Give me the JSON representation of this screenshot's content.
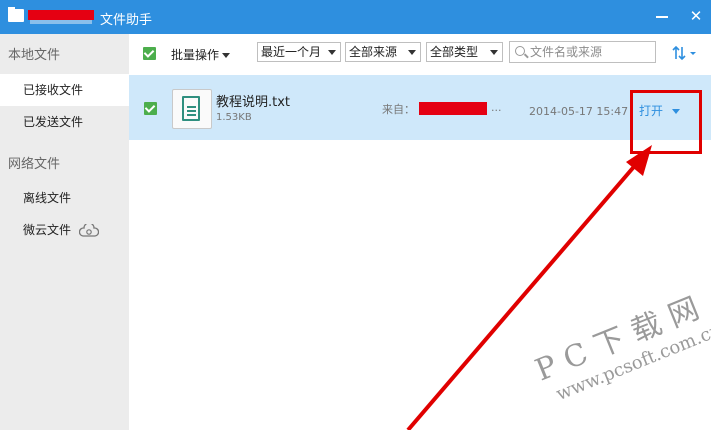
{
  "window": {
    "title": "文件助手",
    "minimize_label": "—",
    "close_label": "✕"
  },
  "sidebar": {
    "local_section": "本地文件",
    "network_section": "网络文件",
    "items": [
      {
        "label": "已接收文件"
      },
      {
        "label": "已发送文件"
      },
      {
        "label": "离线文件"
      },
      {
        "label": "微云文件"
      }
    ]
  },
  "toolbar": {
    "batch_label": "批量操作",
    "filters": [
      "最近一个月",
      "全部来源",
      "全部类型"
    ],
    "search_placeholder": "文件名或来源"
  },
  "files": [
    {
      "name": "教程说明.txt",
      "size": "1.53KB",
      "from_label": "来自：",
      "from_suffix": "...",
      "date": "2014-05-17 15:47",
      "action": "打开"
    }
  ],
  "watermark": {
    "line1": "PC下载网",
    "line2": "www.pcsoft.com.cn"
  },
  "colors": {
    "accent": "#2e8fdf",
    "selected_row": "#cfe8fa",
    "highlight": "#e00000",
    "sidebar_bg": "#ececec"
  }
}
